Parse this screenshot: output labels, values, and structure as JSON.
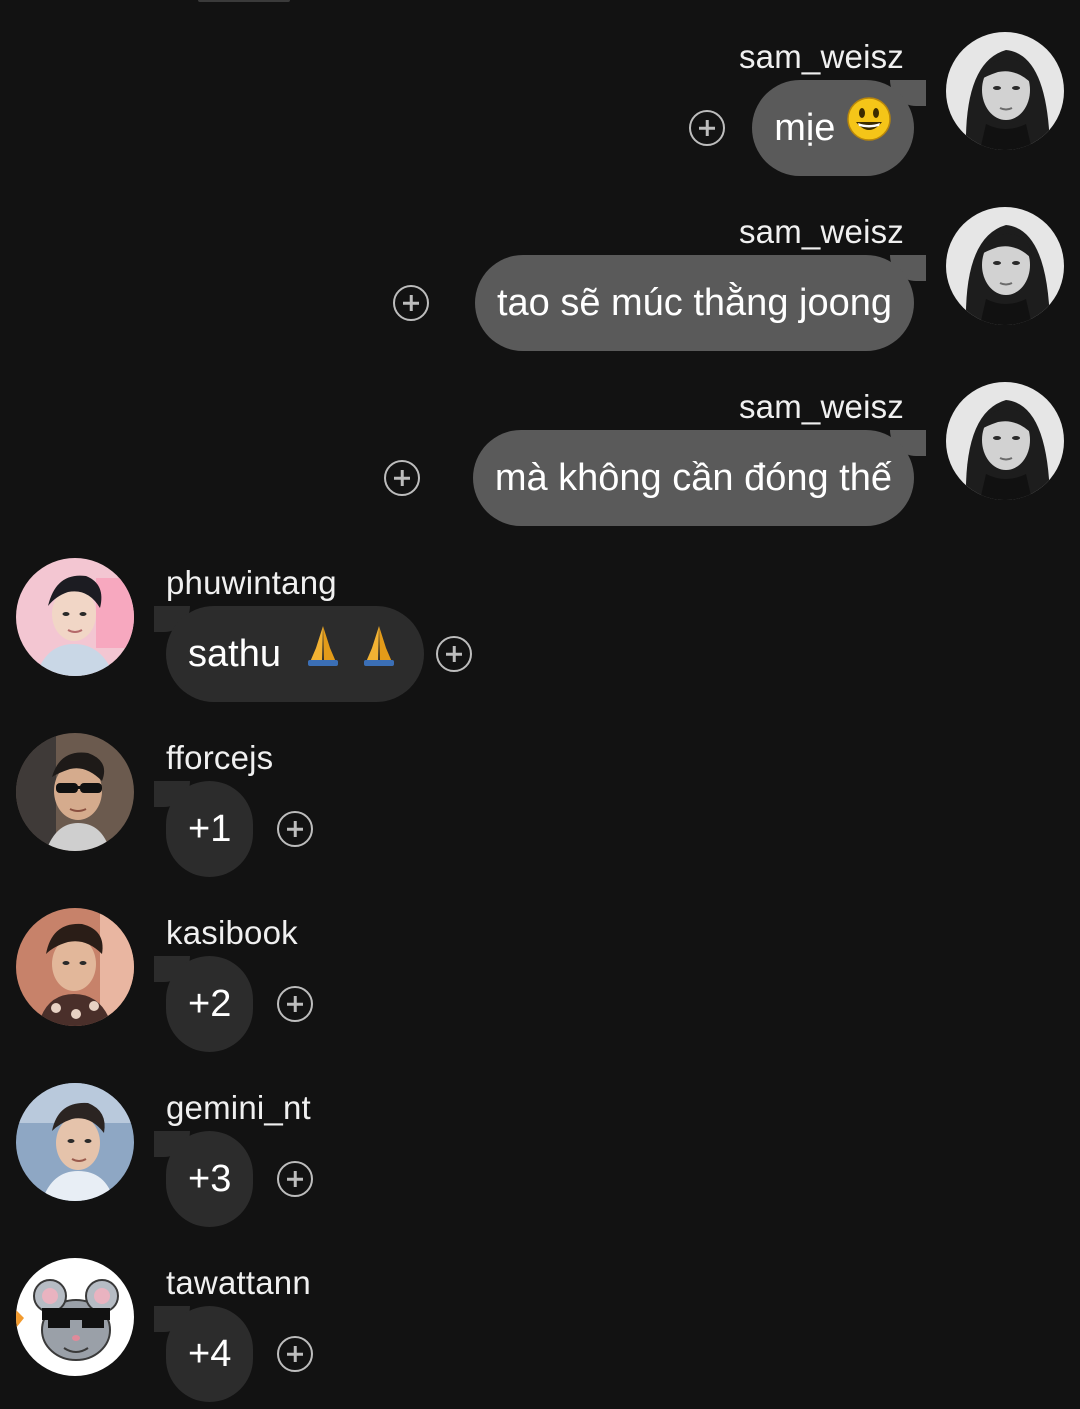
{
  "messages": [
    {
      "username": "sam_weisz",
      "text": "mịe",
      "emoji": "smiley-emoji",
      "direction": "outgoing"
    },
    {
      "username": "sam_weisz",
      "text": "tao sẽ múc thằng joong",
      "direction": "outgoing"
    },
    {
      "username": "sam_weisz",
      "text": "mà không cần đóng thế",
      "direction": "outgoing"
    },
    {
      "username": "phuwintang",
      "text": "sathu",
      "emoji": "folded-hands-emoji",
      "emoji_count": 2,
      "direction": "incoming"
    },
    {
      "username": "fforcejs",
      "text": "+1",
      "direction": "incoming"
    },
    {
      "username": "kasibook",
      "text": "+2",
      "direction": "incoming"
    },
    {
      "username": "gemini_nt",
      "text": "+3",
      "direction": "incoming"
    },
    {
      "username": "tawattann",
      "text": "+4",
      "direction": "incoming"
    }
  ],
  "icons": {
    "add_reaction": "plus-circle-icon"
  },
  "colors": {
    "background": "#121212",
    "outgoing_bubble": "#5a5a5a",
    "incoming_bubble": "#2c2c2c",
    "text": "#ffffff",
    "icon": "#bdbdbd"
  }
}
